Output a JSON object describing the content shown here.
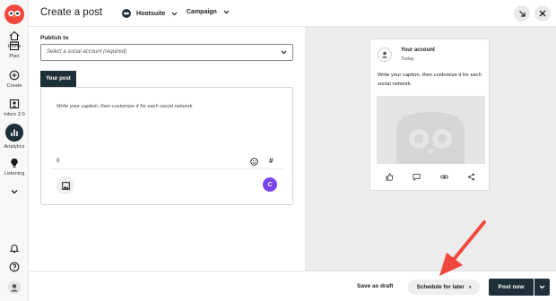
{
  "nav": {
    "items": [
      {
        "label": "Home",
        "icon": "home-icon"
      },
      {
        "label": "Plan",
        "icon": "calendar-icon"
      },
      {
        "label": "Create",
        "icon": "plus-circle-icon"
      },
      {
        "label": "Inbox 2.0",
        "icon": "inbox-icon"
      },
      {
        "label": "Analytics",
        "icon": "bar-chart-icon"
      },
      {
        "label": "Listening",
        "icon": "lightbulb-icon"
      }
    ],
    "active": "Analytics",
    "bottom_icons": [
      "bell-icon",
      "help-icon",
      "user-avatar-icon"
    ]
  },
  "header": {
    "title": "Create a post",
    "org_label": "Hootsuite",
    "campaign_label": "Campaign",
    "minimize_icon": "arrow-down-right-icon",
    "close_icon": "close-icon"
  },
  "editor": {
    "publish_to_label": "Publish to",
    "account_placeholder": "Select a social account (required)",
    "tab_label": "Your post",
    "caption_placeholder": "Write your caption, then customize it for each social network",
    "char_count": "0",
    "hashtag_symbol": "#"
  },
  "preview": {
    "account_name": "Your account",
    "time": "Today",
    "caption": "Write your caption, then customize it for each social network"
  },
  "footer": {
    "save_draft_label": "Save as draft",
    "schedule_label": "Schedule for later",
    "post_now_label": "Post now"
  },
  "colors": {
    "primary_dark": "#1f2f3a",
    "ai_purple": "#7a43e8",
    "annotation_arrow": "#f0483e",
    "brand_red": "#f0483e"
  }
}
